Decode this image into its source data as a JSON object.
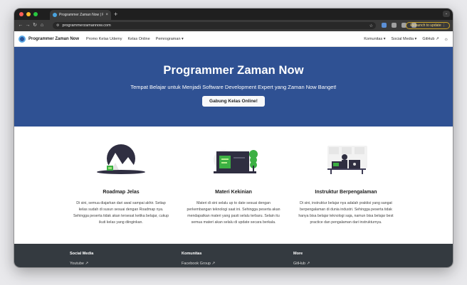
{
  "browser": {
    "tab_title": "Programmer Zaman Now | Pro...",
    "tab_close": "×",
    "new_tab": "+",
    "tab_menu": "⌄",
    "url": "programmerzamannow.com",
    "relaunch_label": "Relaunch to update ⋮",
    "nav_back": "←",
    "nav_forward": "→",
    "nav_reload": "↻",
    "nav_home": "⌂",
    "omni_icon": "⚙",
    "star": "☆",
    "toolbar_icon_colors": [
      "#5b8fd6",
      "#a0a0a0",
      "#a0a0a0",
      "#a0a0a0"
    ]
  },
  "navbar": {
    "brand": "Programmer Zaman Now",
    "links": [
      "Promo Kelas Udemy",
      "Kelas Online",
      "Pemrograman ▾"
    ],
    "right_links": [
      "Komunitas ▾",
      "Social Media ▾",
      "GitHub ↗"
    ],
    "theme_icon": "☼"
  },
  "hero": {
    "title": "Programmer Zaman Now",
    "subtitle": "Tempat Belajar untuk Menjadi Software Development Expert yang Zaman Now Banget!",
    "button": "Gabung Kelas Online!",
    "bg_color": "#2f5193"
  },
  "features": [
    {
      "icon": "mountain-illustration",
      "title": "Roadmap Jelas",
      "text": "Di sini, semua diajarkan dari awal sampai akhir. Setiap kelas sudah di susun sesuai dengan Roadmap nya. Sehingga peserta tidak akan tersesat ketika belajar, cukup ikuti kelas yang diinginkan."
    },
    {
      "icon": "laptop-tree-illustration",
      "title": "Materi Kekinian",
      "text": "Materi di sini selalu up to date sesuai dengan perkembangan teknologi saat ini. Sehingga peserta akan mendapatkan materi yang pasti selalu terbaru. Selain itu semua materi akan selalu di update secara berkala."
    },
    {
      "icon": "instructor-desk-illustration",
      "title": "Instruktur Berpengalaman",
      "text": "Di sini, instruktur belajar nya adalah praktisi yang sangat berpengalaman di dunia industri. Sehingga peserta tidak hanya bisa belajar teknologi saja, namun bisa belajar best practice dan pengalaman dari instrukturnya."
    }
  ],
  "footer": {
    "columns": [
      {
        "title": "Social Media",
        "link": "Youtube ↗"
      },
      {
        "title": "Komunitas",
        "link": "Facebook Group ↗"
      },
      {
        "title": "More",
        "link": "GitHub ↗"
      }
    ]
  },
  "colors": {
    "accent_green": "#3cb043",
    "footer_bg": "#343a40"
  }
}
